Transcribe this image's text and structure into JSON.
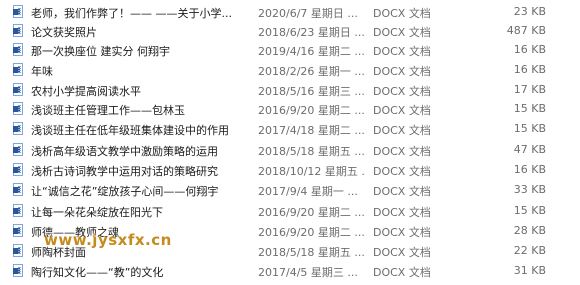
{
  "rows": [
    {
      "name": "老师，我们作弊了！—— ——关于小学...",
      "date": "2020/6/7 星期日 ...",
      "type": "DOCX 文档",
      "size": "23 KB"
    },
    {
      "name": "论文获奖照片",
      "date": "2018/6/23 星期日 ...",
      "type": "DOCX 文档",
      "size": "487 KB"
    },
    {
      "name": "那一次换座位 建实分 何翔宇",
      "date": "2019/4/16 星期二 ...",
      "type": "DOCX 文档",
      "size": "16 KB"
    },
    {
      "name": "年味",
      "date": "2018/2/26 星期一 ...",
      "type": "DOCX 文档",
      "size": "16 KB"
    },
    {
      "name": "农村小学提高阅读水平",
      "date": "2018/5/16 星期三 ...",
      "type": "DOCX 文档",
      "size": "17 KB"
    },
    {
      "name": "浅谈班主任管理工作——包林玉",
      "date": "2016/9/20 星期二 ...",
      "type": "DOCX 文档",
      "size": "15 KB"
    },
    {
      "name": "浅谈班主任在低年级班集体建设中的作用",
      "date": "2017/4/18 星期二 ...",
      "type": "DOCX 文档",
      "size": "15 KB"
    },
    {
      "name": "浅析高年级语文教学中激励策略的运用",
      "date": "2018/5/18 星期五 ...",
      "type": "DOCX 文档",
      "size": "47 KB"
    },
    {
      "name": "浅析古诗词教学中运用对话的策略研究",
      "date": "2018/10/12 星期五 ...",
      "type": "DOCX 文档",
      "size": "16 KB"
    },
    {
      "name": "让“诚信之花”绽放孩子心间——何翔宇",
      "date": "2017/9/4 星期一 ...",
      "type": "DOCX 文档",
      "size": "33 KB"
    },
    {
      "name": "让每一朵花朵绽放在阳光下",
      "date": "2016/9/20 星期二 ...",
      "type": "DOCX 文档",
      "size": "15 KB"
    },
    {
      "name": "师德——教师之魂",
      "date": "2016/9/20 星期二 ...",
      "type": "DOCX 文档",
      "size": "28 KB"
    },
    {
      "name": "师陶杯封面",
      "date": "2018/5/18 星期五 ...",
      "type": "DOCX 文档",
      "size": "22 KB"
    },
    {
      "name": "陶行知文化——“教”的文化",
      "date": "2017/4/5 星期三 ...",
      "type": "DOCX 文档",
      "size": "31 KB"
    }
  ],
  "watermark": "www.jysxfx.cn"
}
